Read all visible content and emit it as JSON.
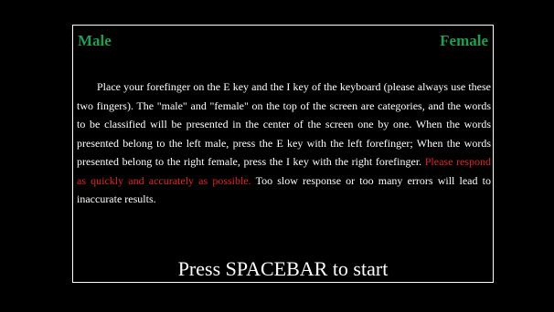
{
  "categories": {
    "left": "Male",
    "right": "Female"
  },
  "instructions": {
    "text_before": "Place your forefinger on the E key and the I key of the keyboard (please always use these two fingers). The \"male\" and \"female\" on the top of the screen are categories, and the words to be classified will be presented in the center of the screen one by one. When the words presented belong to the left male, press the E key with the left forefinger; When the words presented belong to the right female, press the I key with the right forefinger. ",
    "text_warning": "Please respond as quickly and accurately as possible.",
    "text_after": " Too slow response or too many errors will lead to inaccurate results."
  },
  "prompt": {
    "start_label": "Press SPACEBAR to start"
  },
  "colors": {
    "background": "#000000",
    "category": "#1f9e4f",
    "warning": "#e0242a",
    "text": "#ffffff"
  }
}
